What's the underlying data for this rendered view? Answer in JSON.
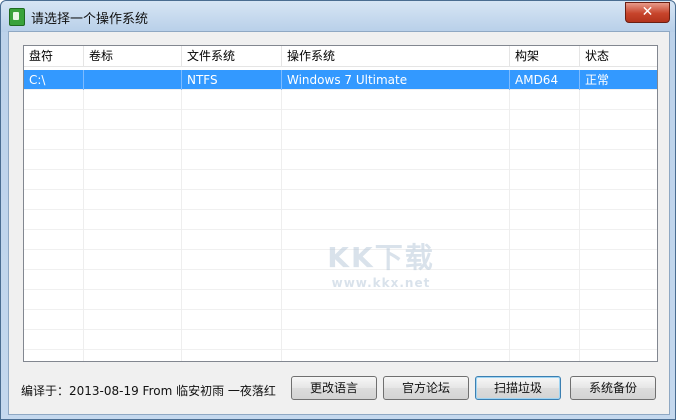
{
  "window": {
    "title": "请选择一个操作系统",
    "close_label": "✕"
  },
  "table": {
    "columns": [
      "盘符",
      "卷标",
      "文件系统",
      "操作系统",
      "构架",
      "状态"
    ],
    "rows": [
      [
        "C:\\",
        "",
        "NTFS",
        "Windows 7 Ultimate",
        "AMD64",
        "正常"
      ]
    ]
  },
  "footer": {
    "build_info": "编译于：2013-08-19 From 临安初雨 一夜落红"
  },
  "buttons": {
    "language": "更改语言",
    "forum": "官方论坛",
    "scan": "扫描垃圾",
    "backup": "系统备份"
  },
  "watermark": {
    "logo": "KK下载",
    "url": "www.kkx.net"
  },
  "colors": {
    "selection": "#3399ff",
    "close_button": "#c7442b"
  }
}
